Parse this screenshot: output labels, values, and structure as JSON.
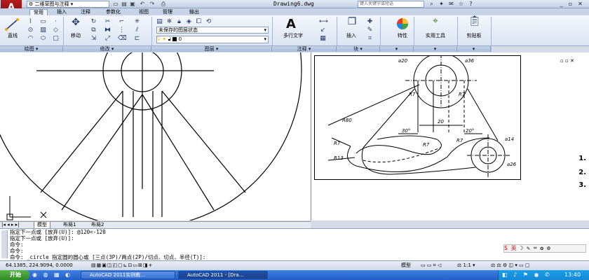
{
  "titlebar": {
    "app_logo": "A",
    "workspace": "二维草图与注释",
    "doc_title": "Drawing6.dwg",
    "search_placeholder": "键入关键字或短语"
  },
  "tabs": [
    "常用",
    "插入",
    "注释",
    "参数化",
    "视图",
    "管理",
    "输出"
  ],
  "ribbon": {
    "draw_panel": {
      "title": "绘图",
      "line_label": "直线"
    },
    "modify_panel": {
      "title": "修改",
      "move_label": "移动"
    },
    "layers_panel": {
      "title": "图层",
      "layer_state": "未保存的图层状态"
    },
    "annotation_panel": {
      "title": "注释",
      "mtext_label": "多行文字"
    },
    "block_panel": {
      "title": "块",
      "insert_label": "插入"
    },
    "properties": {
      "label": "特性"
    },
    "utilities": {
      "label": "实用工具"
    },
    "clipboard": {
      "label": "剪贴板"
    }
  },
  "layout_tabs": [
    "模型",
    "布局1",
    "布局2"
  ],
  "drawing_right": {
    "dims": {
      "d20": "⌀20",
      "d36": "⌀36",
      "r7a": "R7",
      "r7b": "R7",
      "r80": "R80",
      "r7c": "R7",
      "r13": "R13",
      "r7d": "R7",
      "d14": "⌀14",
      "d26": "⌀26",
      "w20": "20",
      "a30": "30°",
      "a20": "20°",
      "r7e": "R7"
    }
  },
  "side_steps": [
    "1.",
    "2.",
    "3."
  ],
  "command_lines": [
    "指定下一点或 [放弃(U)]: @120<-120",
    "指定下一点或 [放弃(U)]:",
    "命令:",
    "命令:",
    "命令: _circle 指定圆的圆心或 [三点(3P)/两点(2P)/切点、切点、半径(T)]:"
  ],
  "status": {
    "coords": "64.1385, 224.9094, 0.0000",
    "model": "模型",
    "scale": "1:1"
  },
  "taskbar": {
    "start": "开始",
    "tasks": [
      "AutoCAD 2011实例教...",
      "AutoCAD 2011 - [Dra..."
    ],
    "clock": "13:40",
    "ime": "英"
  }
}
